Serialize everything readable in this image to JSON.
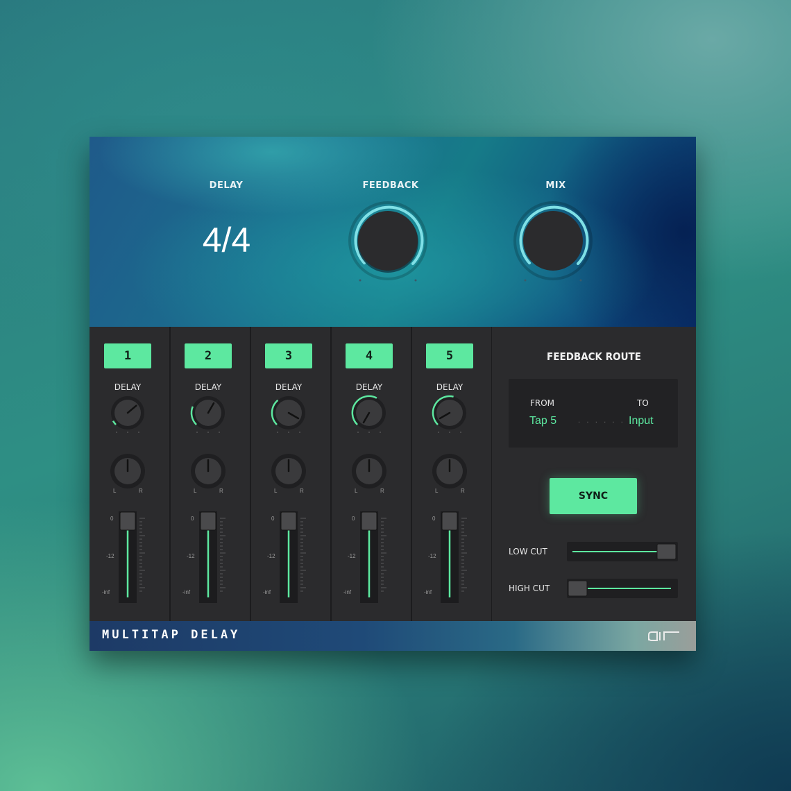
{
  "top": {
    "delay_label": "DELAY",
    "delay_value": "4/4",
    "feedback_label": "FEEDBACK",
    "mix_label": "MIX"
  },
  "taps": [
    {
      "number": "1",
      "delay_label": "DELAY",
      "pan_left": "L",
      "pan_right": "R"
    },
    {
      "number": "2",
      "delay_label": "DELAY",
      "pan_left": "L",
      "pan_right": "R"
    },
    {
      "number": "3",
      "delay_label": "DELAY",
      "pan_left": "L",
      "pan_right": "R"
    },
    {
      "number": "4",
      "delay_label": "DELAY",
      "pan_left": "L",
      "pan_right": "R"
    },
    {
      "number": "5",
      "delay_label": "DELAY",
      "pan_left": "L",
      "pan_right": "R"
    }
  ],
  "fader_scale": [
    "0",
    "-12",
    "-inf"
  ],
  "feedback_route": {
    "title": "FEEDBACK ROUTE",
    "from_label": "FROM",
    "to_label": "TO",
    "from_value": "Tap 5",
    "to_value": "Input",
    "dots": "· · · · · ·"
  },
  "sync_label": "SYNC",
  "low_cut_label": "LOW CUT",
  "high_cut_label": "HIGH CUT",
  "footer": {
    "title": "MULTITAP DELAY",
    "logo": "air"
  },
  "colors": {
    "accent": "#5de8a0",
    "knob_ring": "#7fe0e6",
    "panel": "#2b2b2d"
  }
}
